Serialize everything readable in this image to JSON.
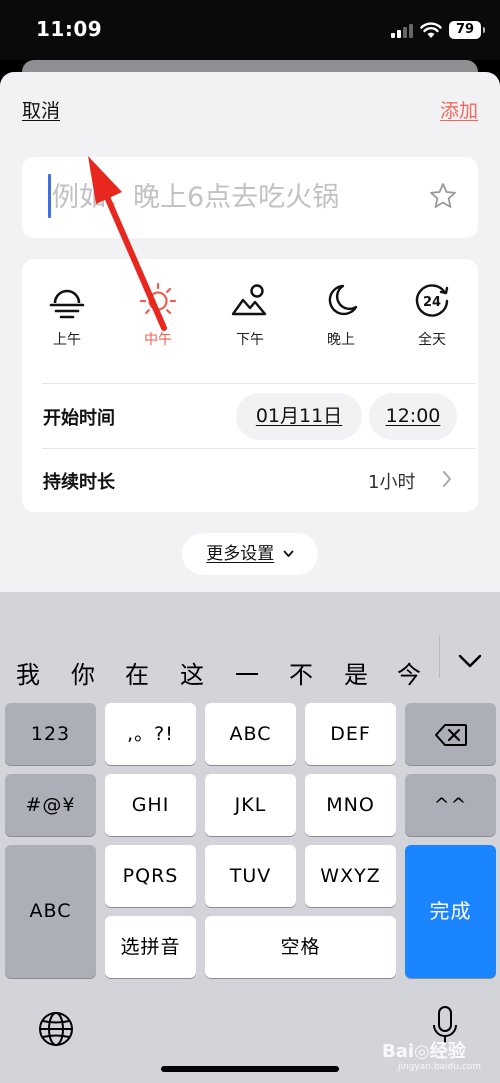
{
  "status_bar": {
    "time": "11:09",
    "battery": "79"
  },
  "header": {
    "cancel_label": "取消",
    "add_label": "添加"
  },
  "title_input": {
    "placeholder": "例如：晚上6点去吃火锅",
    "value": ""
  },
  "periods": [
    {
      "label": "上午",
      "icon": "sunrise-icon",
      "active": false
    },
    {
      "label": "中午",
      "icon": "sun-icon",
      "active": true
    },
    {
      "label": "下午",
      "icon": "sun-mountain-icon",
      "active": false
    },
    {
      "label": "晚上",
      "icon": "moon-icon",
      "active": false
    },
    {
      "label": "全天",
      "icon": "24-hour-icon",
      "active": false
    }
  ],
  "start_time": {
    "label": "开始时间",
    "date": "01月11日",
    "time": "12:00"
  },
  "duration": {
    "label": "持续时长",
    "value": "1小时"
  },
  "more_settings": {
    "label": "更多设置"
  },
  "keyboard": {
    "candidates": [
      "我",
      "你",
      "在",
      "这",
      "一",
      "不",
      "是",
      "今天"
    ],
    "keys": {
      "numbers": "123",
      "punct": ",。?!",
      "abc": "ABC",
      "def": "DEF",
      "symbols": "#@¥",
      "ghi": "GHI",
      "jkl": "JKL",
      "mno": "MNO",
      "face": "^^",
      "abc_switch": "ABC",
      "pqrs": "PQRS",
      "tuv": "TUV",
      "wxyz": "WXYZ",
      "done": "完成",
      "pinyin": "选拼音",
      "space": "空格"
    }
  },
  "watermark": {
    "text": "Bai◎经验",
    "sub": "jingyan.baidu.com"
  },
  "colors": {
    "accent_red": "#f2695c",
    "active_period": "#ee6150",
    "cursor_blue": "#3a6fe8",
    "done_blue": "#1b84ff",
    "arrow_red": "#e8281e"
  }
}
